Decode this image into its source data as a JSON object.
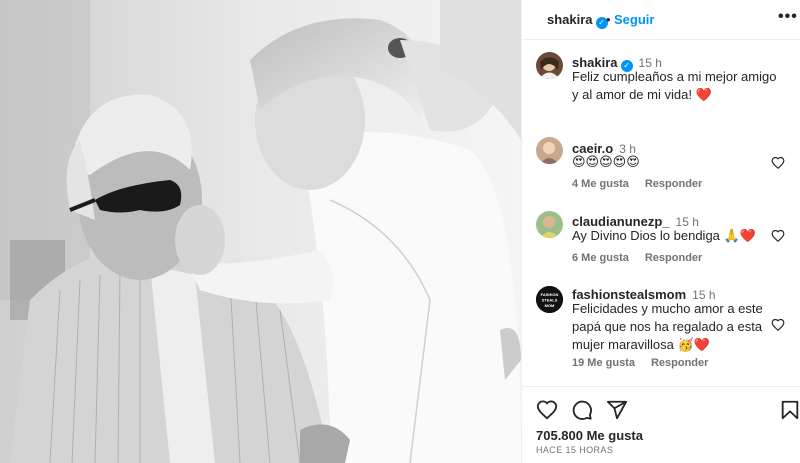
{
  "post": {
    "username": "shakira",
    "verified_mark": "✓",
    "separator": "•",
    "follow_label": "Seguir",
    "more_label": "•••",
    "image_icon": "photo-black-white-father-daughter"
  },
  "caption": {
    "username": "shakira",
    "time": "15 h",
    "text": "Feliz cumpleaños a mi mejor amigo y al amor de mi vida! ❤️"
  },
  "comments": [
    {
      "username": "caeir.o",
      "time": "3 h",
      "text": "😍😍😍😍😍",
      "likes": "4 Me gusta",
      "reply": "Responder"
    },
    {
      "username": "claudianunezp_",
      "time": "15 h",
      "text": "Ay Divino Dios lo bendiga 🙏❤️",
      "likes": "6 Me gusta",
      "reply": "Responder"
    },
    {
      "username": "fashionstealsmom",
      "time": "15 h",
      "text": "Felicidades y mucho amor a este papá que nos ha regalado a esta mujer maravillosa 🥳❤️",
      "likes": "19 Me gusta",
      "reply": "Responder",
      "avatar_text": "FASHION STEALS MOM"
    }
  ],
  "footer": {
    "likes": "705.800 Me gusta",
    "date": "HACE 15 HORAS"
  },
  "colors": {
    "accent": "#0095f6",
    "heart": "#ed4956",
    "muted": "#737373"
  }
}
